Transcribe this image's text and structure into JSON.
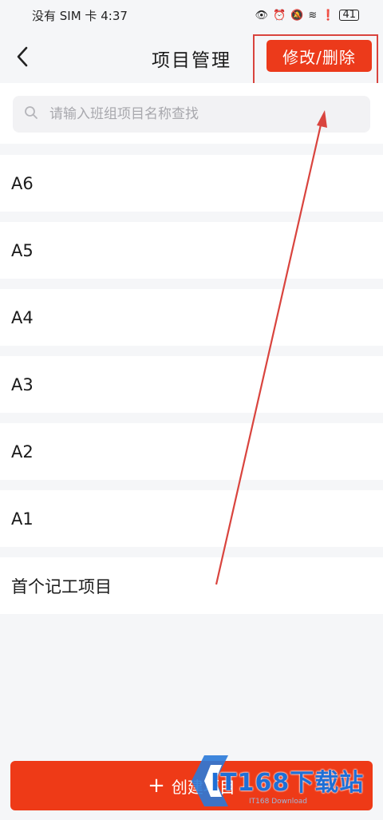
{
  "status_bar": {
    "carrier": "没有 SIM 卡",
    "time": "4:37",
    "battery": "41"
  },
  "header": {
    "title": "项目管理",
    "edit_delete_label": "修改/删除"
  },
  "search": {
    "placeholder": "请输入班组项目名称查找"
  },
  "projects": [
    "A6",
    "A5",
    "A4",
    "A3",
    "A2",
    "A1",
    "首个记工项目"
  ],
  "footer": {
    "create_label": "创建项目"
  },
  "watermark": {
    "text": "IT168下载站",
    "sub": "IT168 Download"
  },
  "colors": {
    "accent": "#ec3a1b",
    "annotation": "#d9443e"
  },
  "icons": [
    "back-icon",
    "search-icon",
    "plus-icon"
  ]
}
